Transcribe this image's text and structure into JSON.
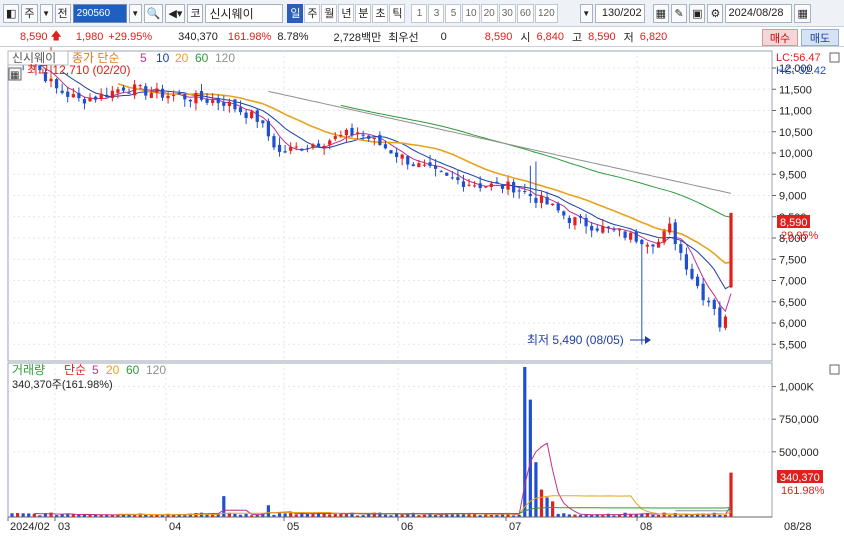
{
  "toolbar": {
    "market_btn": "주",
    "prev_btn": "전",
    "code": "290560",
    "name_prefix": "코",
    "stock_name": "신시웨이",
    "periods": [
      "일",
      "주",
      "월",
      "년",
      "분",
      "초",
      "틱"
    ],
    "active_period": "일",
    "intervals": [
      "1",
      "3",
      "5",
      "10",
      "20",
      "30",
      "60",
      "120"
    ],
    "count": "130",
    "count_total": "/202",
    "date": "2024/08/28"
  },
  "quote": {
    "price": "8,590",
    "change": "1,980",
    "change_pct": "+29.95%",
    "volume": "340,370",
    "volume_ratio": "161.98%",
    "turnover": "8.78%",
    "amount": "2,728백만",
    "best_bid_label": "최우선",
    "best_bid": "0",
    "best_ask": "8,590",
    "open_label": "시",
    "open": "6,840",
    "high_label": "고",
    "high": "8,590",
    "low_label": "저",
    "low": "6,820",
    "buy_label": "매수",
    "sell_label": "매도"
  },
  "price_panel": {
    "stock_label": "신시웨이",
    "ma_label": "종가 단순",
    "ma_periods": [
      "5",
      "10",
      "20",
      "60",
      "120"
    ],
    "max_note": "최고 12,710 (02/20)",
    "min_note": "최저 5,490 (08/05)",
    "lc": "LC:56.47",
    "hc": "HC:-32.42",
    "price_tag": "8,590",
    "pct_tag": "29.95%",
    "y_ticks": [
      "12,000",
      "11,500",
      "11,000",
      "10,500",
      "10,000",
      "9,500",
      "9,000",
      "8,500",
      "8,000",
      "7,500",
      "7,000",
      "6,500",
      "6,000",
      "5,500"
    ]
  },
  "volume_panel": {
    "label": "거래량",
    "ma_label": "단순",
    "ma_periods": [
      "5",
      "20",
      "60",
      "120"
    ],
    "volume_note": "340,370주(161.98%)",
    "y_ticks": [
      "1,000K",
      "750,000",
      "500,000"
    ],
    "vol_tag": "340,370",
    "pct_tag": "161.98%"
  },
  "x_axis": {
    "labels": [
      "2024/02",
      "03",
      "04",
      "05",
      "06",
      "07",
      "08"
    ],
    "end_label": "08/28"
  },
  "colors": {
    "up": "#e0201c",
    "down": "#1f4fd0",
    "ma5": "#c0308c",
    "ma10": "#1f3f9f",
    "ma20": "#e8a21c",
    "ma60": "#2e9a3a",
    "ma120": "#909090"
  },
  "chart_data": {
    "type": "line",
    "title": "신시웨이",
    "x": [
      "2024/02/20",
      "2024/03",
      "2024/04",
      "2024/05",
      "2024/06",
      "2024/07",
      "2024/08/05",
      "2024/08/28"
    ],
    "series": [
      {
        "name": "종가",
        "values": [
          12710,
          11300,
          11200,
          10400,
          9200,
          8200,
          5490,
          8590
        ]
      }
    ],
    "ylim": [
      5200,
      12400
    ]
  }
}
